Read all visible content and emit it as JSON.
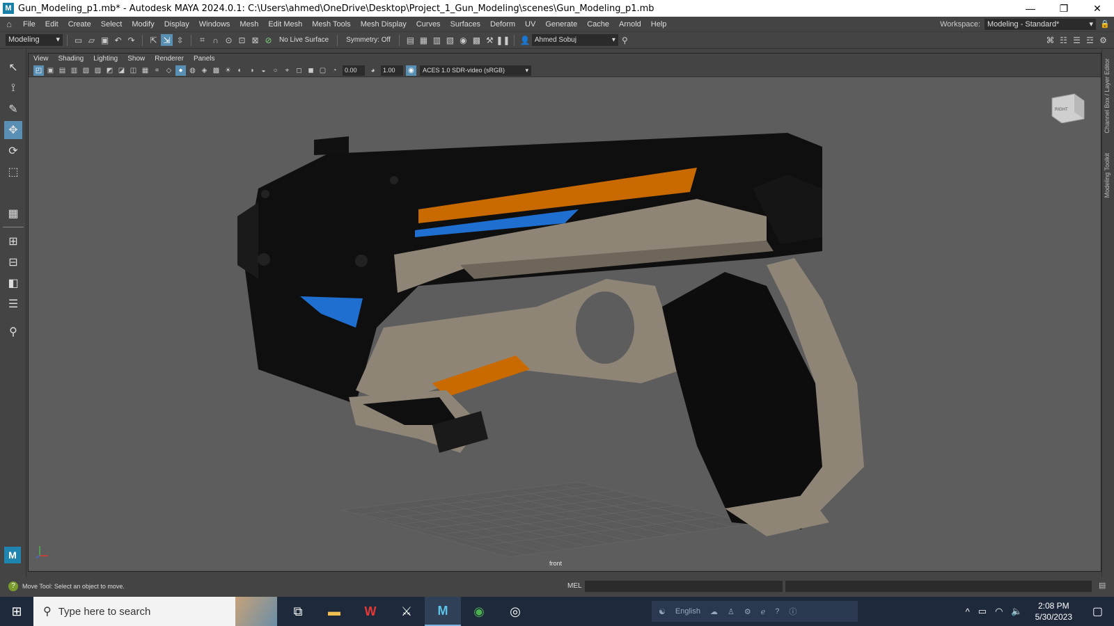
{
  "window": {
    "title": "Gun_Modeling_p1.mb* - Autodesk MAYA 2024.0.1: C:\\Users\\ahmed\\OneDrive\\Desktop\\Project_1_Gun_Modeling\\scenes\\Gun_Modeling_p1.mb",
    "app_icon": "M"
  },
  "menu": [
    "File",
    "Edit",
    "Create",
    "Select",
    "Modify",
    "Display",
    "Windows",
    "Mesh",
    "Edit Mesh",
    "Mesh Tools",
    "Mesh Display",
    "Curves",
    "Surfaces",
    "Deform",
    "UV",
    "Generate",
    "Cache",
    "Arnold",
    "Help"
  ],
  "workspace": {
    "label": "Workspace:",
    "value": "Modeling - Standard*"
  },
  "status": {
    "mode": "Modeling",
    "live_surface": "No Live Surface",
    "symmetry": "Symmetry: Off",
    "user": "Ahmed Sobuj"
  },
  "panel": {
    "menus": [
      "View",
      "Shading",
      "Lighting",
      "Show",
      "Renderer",
      "Panels"
    ],
    "exposure": "0.00",
    "gamma": "1.00",
    "color_space": "ACES 1.0 SDR-video (sRGB)",
    "camera": "front",
    "viewcube_label": "RIGHT"
  },
  "right_tabs": [
    "Channel Box / Layer Editor",
    "Modeling Toolkit"
  ],
  "help": {
    "text": "Move Tool: Select an object to move.",
    "mel_label": "MEL"
  },
  "taskbar": {
    "search_placeholder": "Type here to search",
    "language": "English",
    "time": "2:08 PM",
    "date": "5/30/2023"
  },
  "colors": {
    "accent": "#5a8fb4",
    "gun_orange": "#c96a00",
    "gun_blue": "#1f6fd1",
    "gun_tan": "#8f8576"
  }
}
